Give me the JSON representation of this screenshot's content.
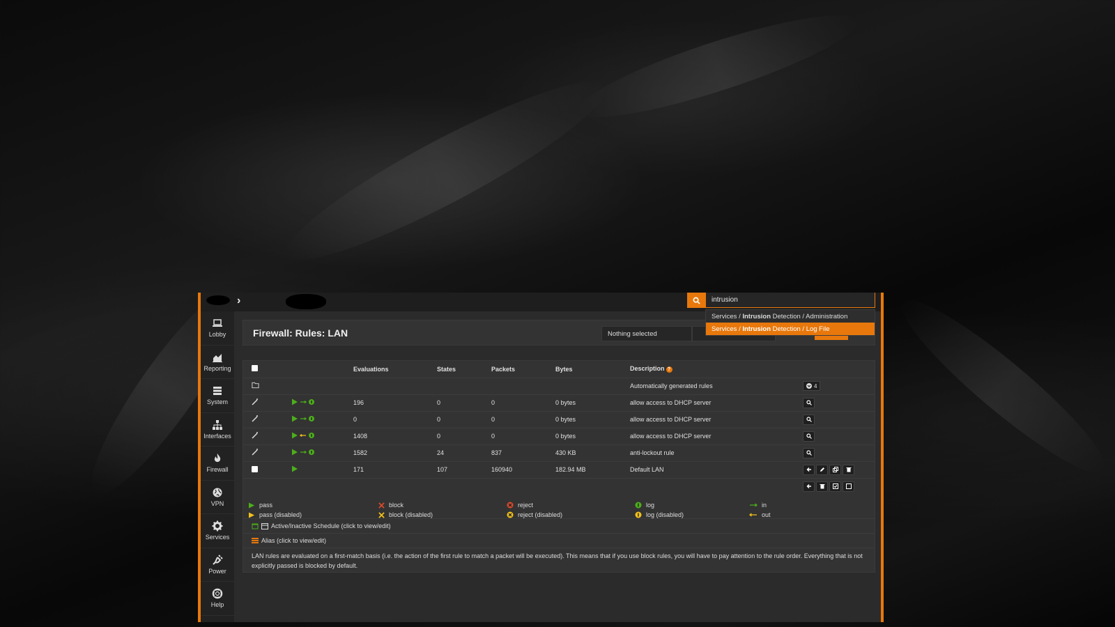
{
  "colors": {
    "accent": "#e8780c",
    "pass": "#4caf1a",
    "disabled": "#f2c21b",
    "block": "#d94a2b",
    "reject": "#d94a2b",
    "log": "#4caf1a"
  },
  "search": {
    "query": "intrusion",
    "results": [
      {
        "prefix": "Services / ",
        "match": "Intrusion",
        "suffix": " Detection / Administration",
        "active": false
      },
      {
        "prefix": "Services / ",
        "match": "Intrusion",
        "suffix": " Detection / Log File",
        "active": true
      }
    ]
  },
  "sidebar": {
    "items": [
      {
        "label": "Lobby",
        "icon": "laptop-icon"
      },
      {
        "label": "Reporting",
        "icon": "area-chart-icon"
      },
      {
        "label": "System",
        "icon": "server-icon"
      },
      {
        "label": "Interfaces",
        "icon": "sitemap-icon"
      },
      {
        "label": "Firewall",
        "icon": "fire-icon"
      },
      {
        "label": "VPN",
        "icon": "globe-icon"
      },
      {
        "label": "Services",
        "icon": "cog-icon"
      },
      {
        "label": "Power",
        "icon": "plug-icon"
      },
      {
        "label": "Help",
        "icon": "life-ring-icon"
      }
    ]
  },
  "page": {
    "title": "Firewall: Rules: LAN",
    "select_placeholder": "Nothing selected"
  },
  "table": {
    "headers": {
      "evaluations": "Evaluations",
      "states": "States",
      "packets": "Packets",
      "bytes": "Bytes",
      "description": "Description",
      "description_help": "?"
    },
    "group_row": {
      "description": "Automatically generated rules",
      "count": "4"
    },
    "rows": [
      {
        "evaluations": "196",
        "states": "0",
        "packets": "0",
        "bytes": "0 bytes",
        "description": "allow access to DHCP server",
        "direction": "in"
      },
      {
        "evaluations": "0",
        "states": "0",
        "packets": "0",
        "bytes": "0 bytes",
        "description": "allow access to DHCP server",
        "direction": "in"
      },
      {
        "evaluations": "1408",
        "states": "0",
        "packets": "0",
        "bytes": "0 bytes",
        "description": "allow access to DHCP server",
        "direction": "out"
      },
      {
        "evaluations": "1582",
        "states": "24",
        "packets": "837",
        "bytes": "430 KB",
        "description": "anti-lockout rule",
        "direction": "in"
      }
    ],
    "user_row": {
      "evaluations": "171",
      "states": "107",
      "packets": "160940",
      "bytes": "182.94 MB",
      "description": "Default LAN"
    }
  },
  "legend": {
    "pass": "pass",
    "pass_disabled": "pass (disabled)",
    "block": "block",
    "block_disabled": "block (disabled)",
    "reject": "reject",
    "reject_disabled": "reject (disabled)",
    "log": "log",
    "log_disabled": "log (disabled)",
    "in": "in",
    "out": "out"
  },
  "info": {
    "schedule": "Active/Inactive Schedule (click to view/edit)",
    "alias": "Alias (click to view/edit)",
    "note": "LAN rules are evaluated on a first-match basis (i.e. the action of the first rule to match a packet will be executed). This means that if you use block rules, you will have to pay attention to the rule order. Everything that is not explicitly passed is blocked by default."
  }
}
